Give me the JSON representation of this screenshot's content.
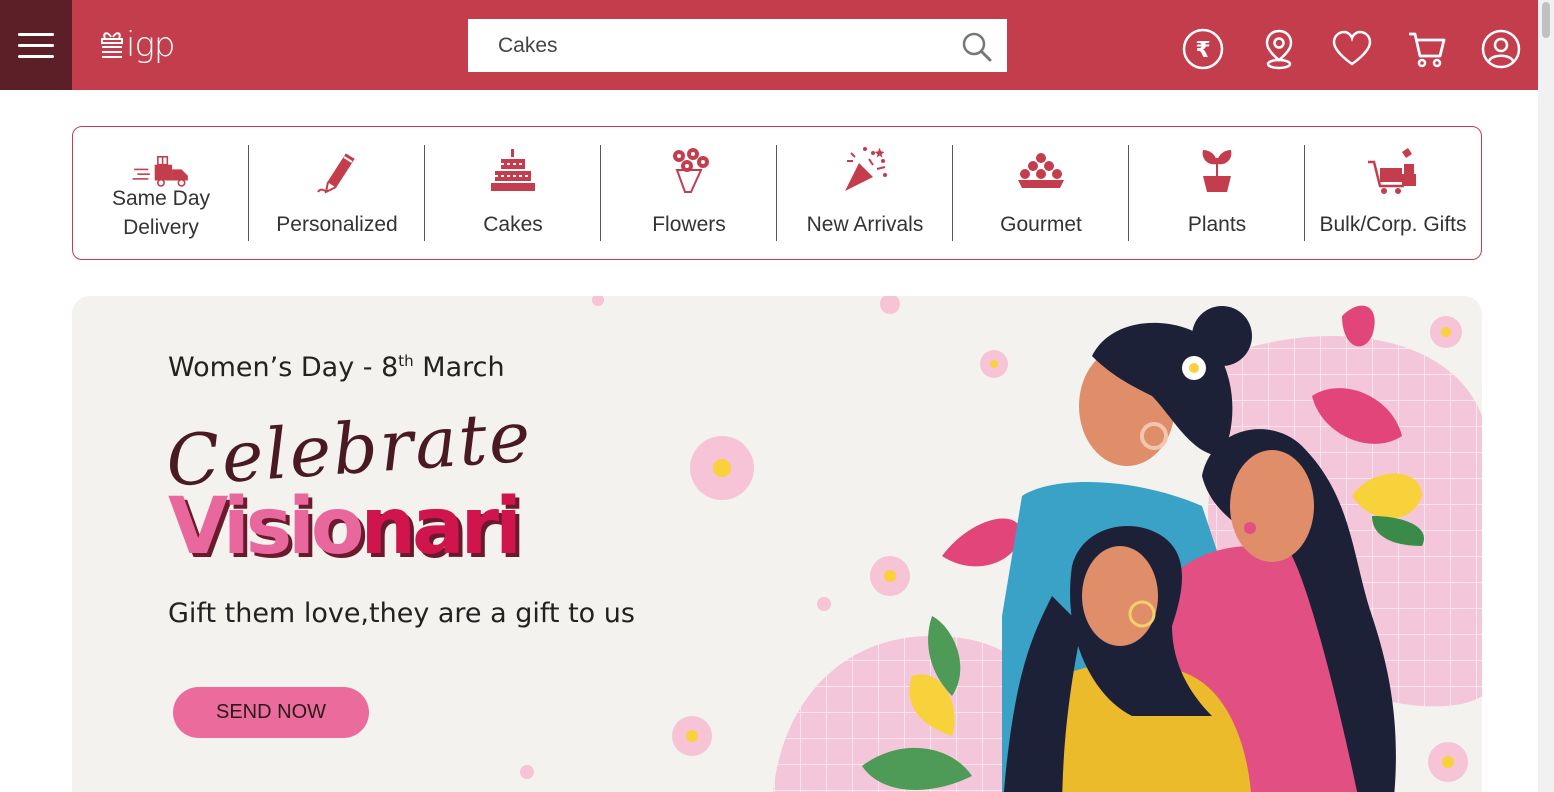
{
  "header": {
    "logo_text": "igp",
    "search": {
      "value": "Cakes",
      "placeholder": "Cakes"
    },
    "icons": [
      "rupee-currency-icon",
      "location-pin-icon",
      "heart-icon",
      "cart-icon",
      "user-icon"
    ],
    "colors": {
      "bar": "#c43d4d",
      "menu_bg": "#5c1f27"
    }
  },
  "categories": [
    {
      "label": "Same Day Delivery",
      "label_line1": "Same Day",
      "label_line2": "Delivery",
      "icon": "delivery-truck-icon"
    },
    {
      "label": "Personalized",
      "icon": "pencil-icon"
    },
    {
      "label": "Cakes",
      "icon": "cake-icon"
    },
    {
      "label": "Flowers",
      "icon": "flower-bouquet-icon"
    },
    {
      "label": "New Arrivals",
      "icon": "party-popper-icon"
    },
    {
      "label": "Gourmet",
      "icon": "sweets-platter-icon"
    },
    {
      "label": "Plants",
      "icon": "potted-plant-icon"
    },
    {
      "label": "Bulk/Corp. Gifts",
      "icon": "gift-cart-icon"
    }
  ],
  "banner": {
    "subtitle_pre": "Women’s Day - 8",
    "subtitle_sup": "th",
    "subtitle_post": " March",
    "script_text": "Celebrate",
    "big_part1": "Visio",
    "big_part2": "nari",
    "tagline": "Gift them love,they are a gift to us",
    "cta": "SEND NOW",
    "colors": {
      "bg": "#f3f2ee",
      "cta": "#eb6c9c",
      "pink": "#e8679c",
      "red": "#d0144c"
    }
  }
}
